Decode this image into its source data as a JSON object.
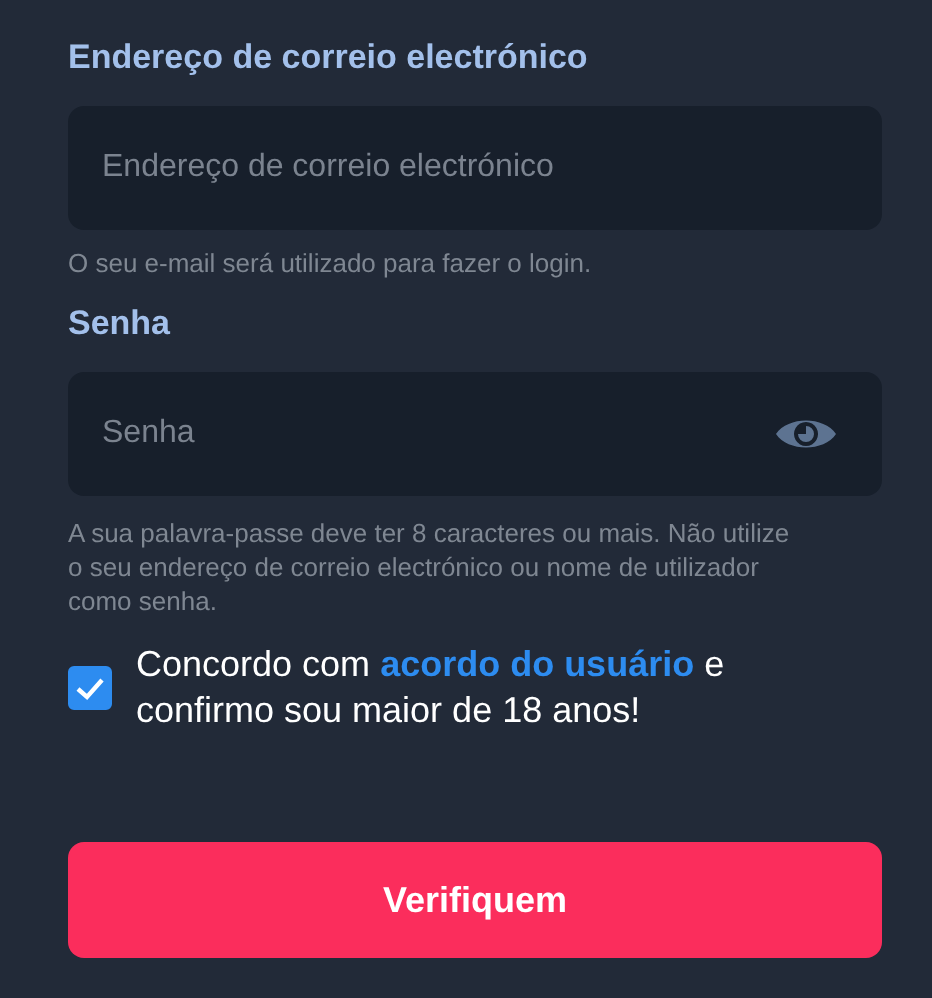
{
  "email": {
    "label": "Endereço de correio electrónico",
    "placeholder": "Endereço de correio electrónico",
    "hint": "O seu e-mail será utilizado para fazer o login."
  },
  "password": {
    "label": "Senha",
    "placeholder": "Senha",
    "hint": "A sua palavra-passe deve ter 8 caracteres ou mais. Não utilize o seu endereço de correio electrónico ou nome de utilizador como senha."
  },
  "agreement": {
    "checked": true,
    "before": "Concordo com ",
    "link": "acordo do usuário",
    "after": " e confirmo sou maior de 18 anos!"
  },
  "submit": {
    "label": "Verifiquem"
  }
}
